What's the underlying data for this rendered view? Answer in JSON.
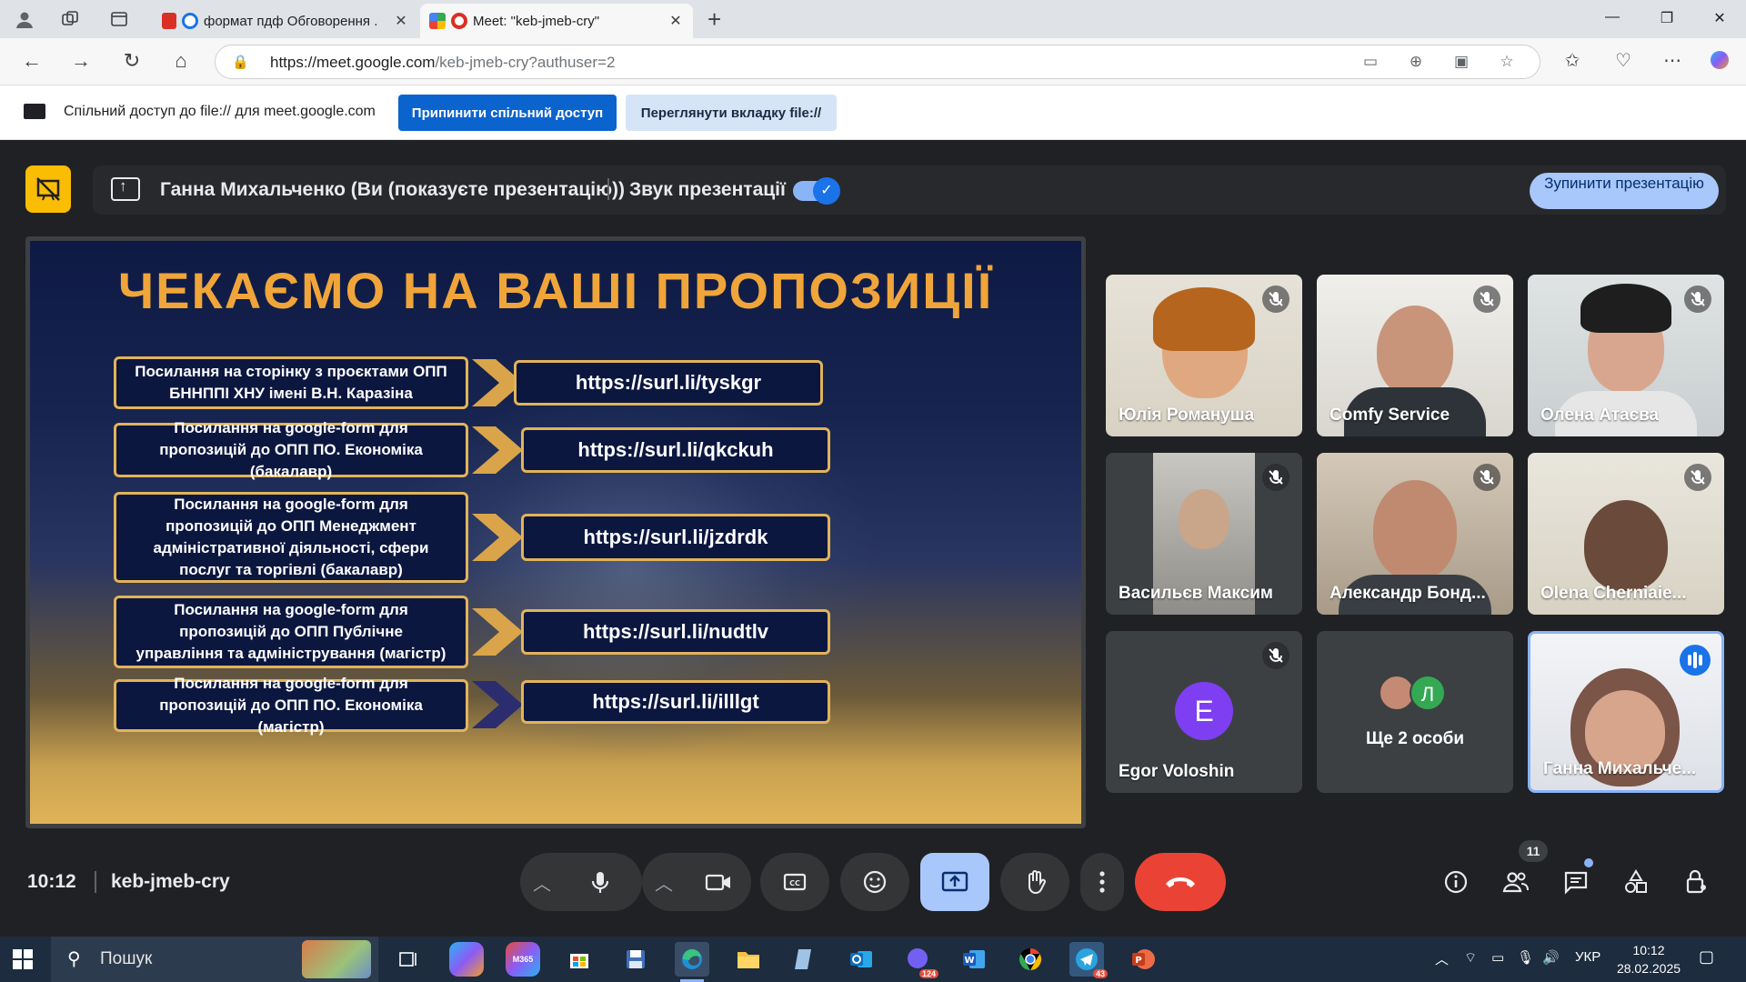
{
  "browser": {
    "tabs": [
      {
        "title": "формат пдф Обговорення ."
      },
      {
        "title": "Meet: \"keb-jmeb-cry\""
      }
    ],
    "url_domain": "https://meet.google.com",
    "url_path": "/keb-jmeb-cry?authuser=2"
  },
  "sharebar": {
    "text": "Спільний доступ до file:// для meet.google.com",
    "stop_label": "Припинити спільний доступ",
    "view_label": "Переглянути вкладку file://"
  },
  "presentation_bar": {
    "presenter": "Ганна Михальченко (Ви (показуєте презентацію))",
    "audio_label": "Звук презентації",
    "audio_on": true,
    "stop_label": "Зупинити презентацію"
  },
  "slide": {
    "title": "ЧЕКАЄМО НА ВАШІ ПРОПОЗИЦІЇ",
    "rows": [
      {
        "left": "Посилання на сторінку з проєктами ОПП БННППІ ХНУ імені В.Н. Каразіна",
        "link": "https://surl.li/tyskgr"
      },
      {
        "left": "Посилання на google-form для пропозицій до ОПП ПО. Економіка (бакалавр)",
        "link": "https://surl.li/qkckuh"
      },
      {
        "left": "Посилання на google-form для пропозицій до ОПП Менеджмент адміністративної діяльності, сфери послуг та торгівлі (бакалавр)",
        "link": "https://surl.li/jzdrdk"
      },
      {
        "left": "Посилання на google-form для пропозицій до ОПП Публічне управління та адміністрування (магістр)",
        "link": "https://surl.li/nudtlv"
      },
      {
        "left": "Посилання на google-form для пропозицій до ОПП ПО. Економіка (магістр)",
        "link": "https://surl.li/illlgt"
      }
    ]
  },
  "participants": [
    {
      "name": "Юлія Романуша",
      "muted": true
    },
    {
      "name": "Comfy Service",
      "muted": true
    },
    {
      "name": "Олена Атаєва",
      "muted": true
    },
    {
      "name": "Васильєв Максим",
      "muted": true
    },
    {
      "name": "Александр Бонд...",
      "muted": true
    },
    {
      "name": "Olena Cherniaie...",
      "muted": true
    },
    {
      "name": "Egor Voloshin",
      "initial": "E",
      "muted": true
    },
    {
      "more_label": "Ще 2 особи",
      "initial": "Л"
    },
    {
      "name": "Ганна Михальче...",
      "speaking": true
    }
  ],
  "meeting": {
    "time": "10:12",
    "code": "keb-jmeb-cry",
    "people_count": "11"
  },
  "taskbar": {
    "search_label": "Пошук",
    "lang": "УКР",
    "time": "10:12",
    "date": "28.02.2025",
    "viber_count": "124",
    "telegram_count": "43",
    "m365_label": "M365"
  },
  "colors": {
    "meet_bg": "#202124",
    "slide_title": "#f0a53a",
    "slide_border": "#e2b35a",
    "end_call": "#ea4335",
    "present_active": "#a8c7fa"
  }
}
